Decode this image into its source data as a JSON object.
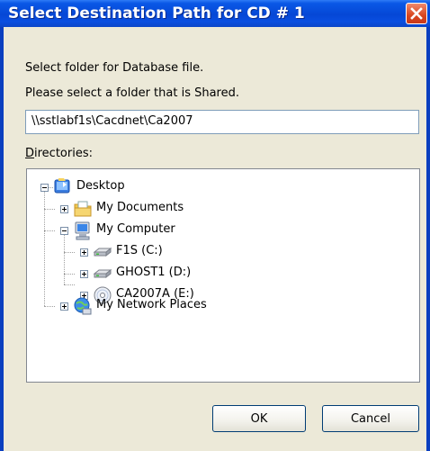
{
  "window": {
    "title": "Select Destination Path for CD # 1"
  },
  "labels": {
    "select_folder": "Select folder for Database file.",
    "shared_note": "Please select a folder that is Shared.",
    "directories_first": "D",
    "directories_rest": "irectories:"
  },
  "path_input": {
    "value": "\\\\sstlabf1s\\Cacdnet\\Ca2007"
  },
  "tree": {
    "desktop": "Desktop",
    "my_documents": "My Documents",
    "my_computer": "My Computer",
    "drive_c": "F1S (C:)",
    "drive_d": "GHOST1 (D:)",
    "drive_e": "CA2007A (E:)",
    "network": "My Network Places"
  },
  "buttons": {
    "ok": "OK",
    "cancel": "Cancel"
  },
  "icons": {
    "desktop": "desktop-icon",
    "documents": "folder-documents-icon",
    "computer": "computer-icon",
    "drive": "hard-drive-icon",
    "cd": "cd-drive-icon",
    "network": "network-places-icon",
    "close": "close-icon"
  }
}
